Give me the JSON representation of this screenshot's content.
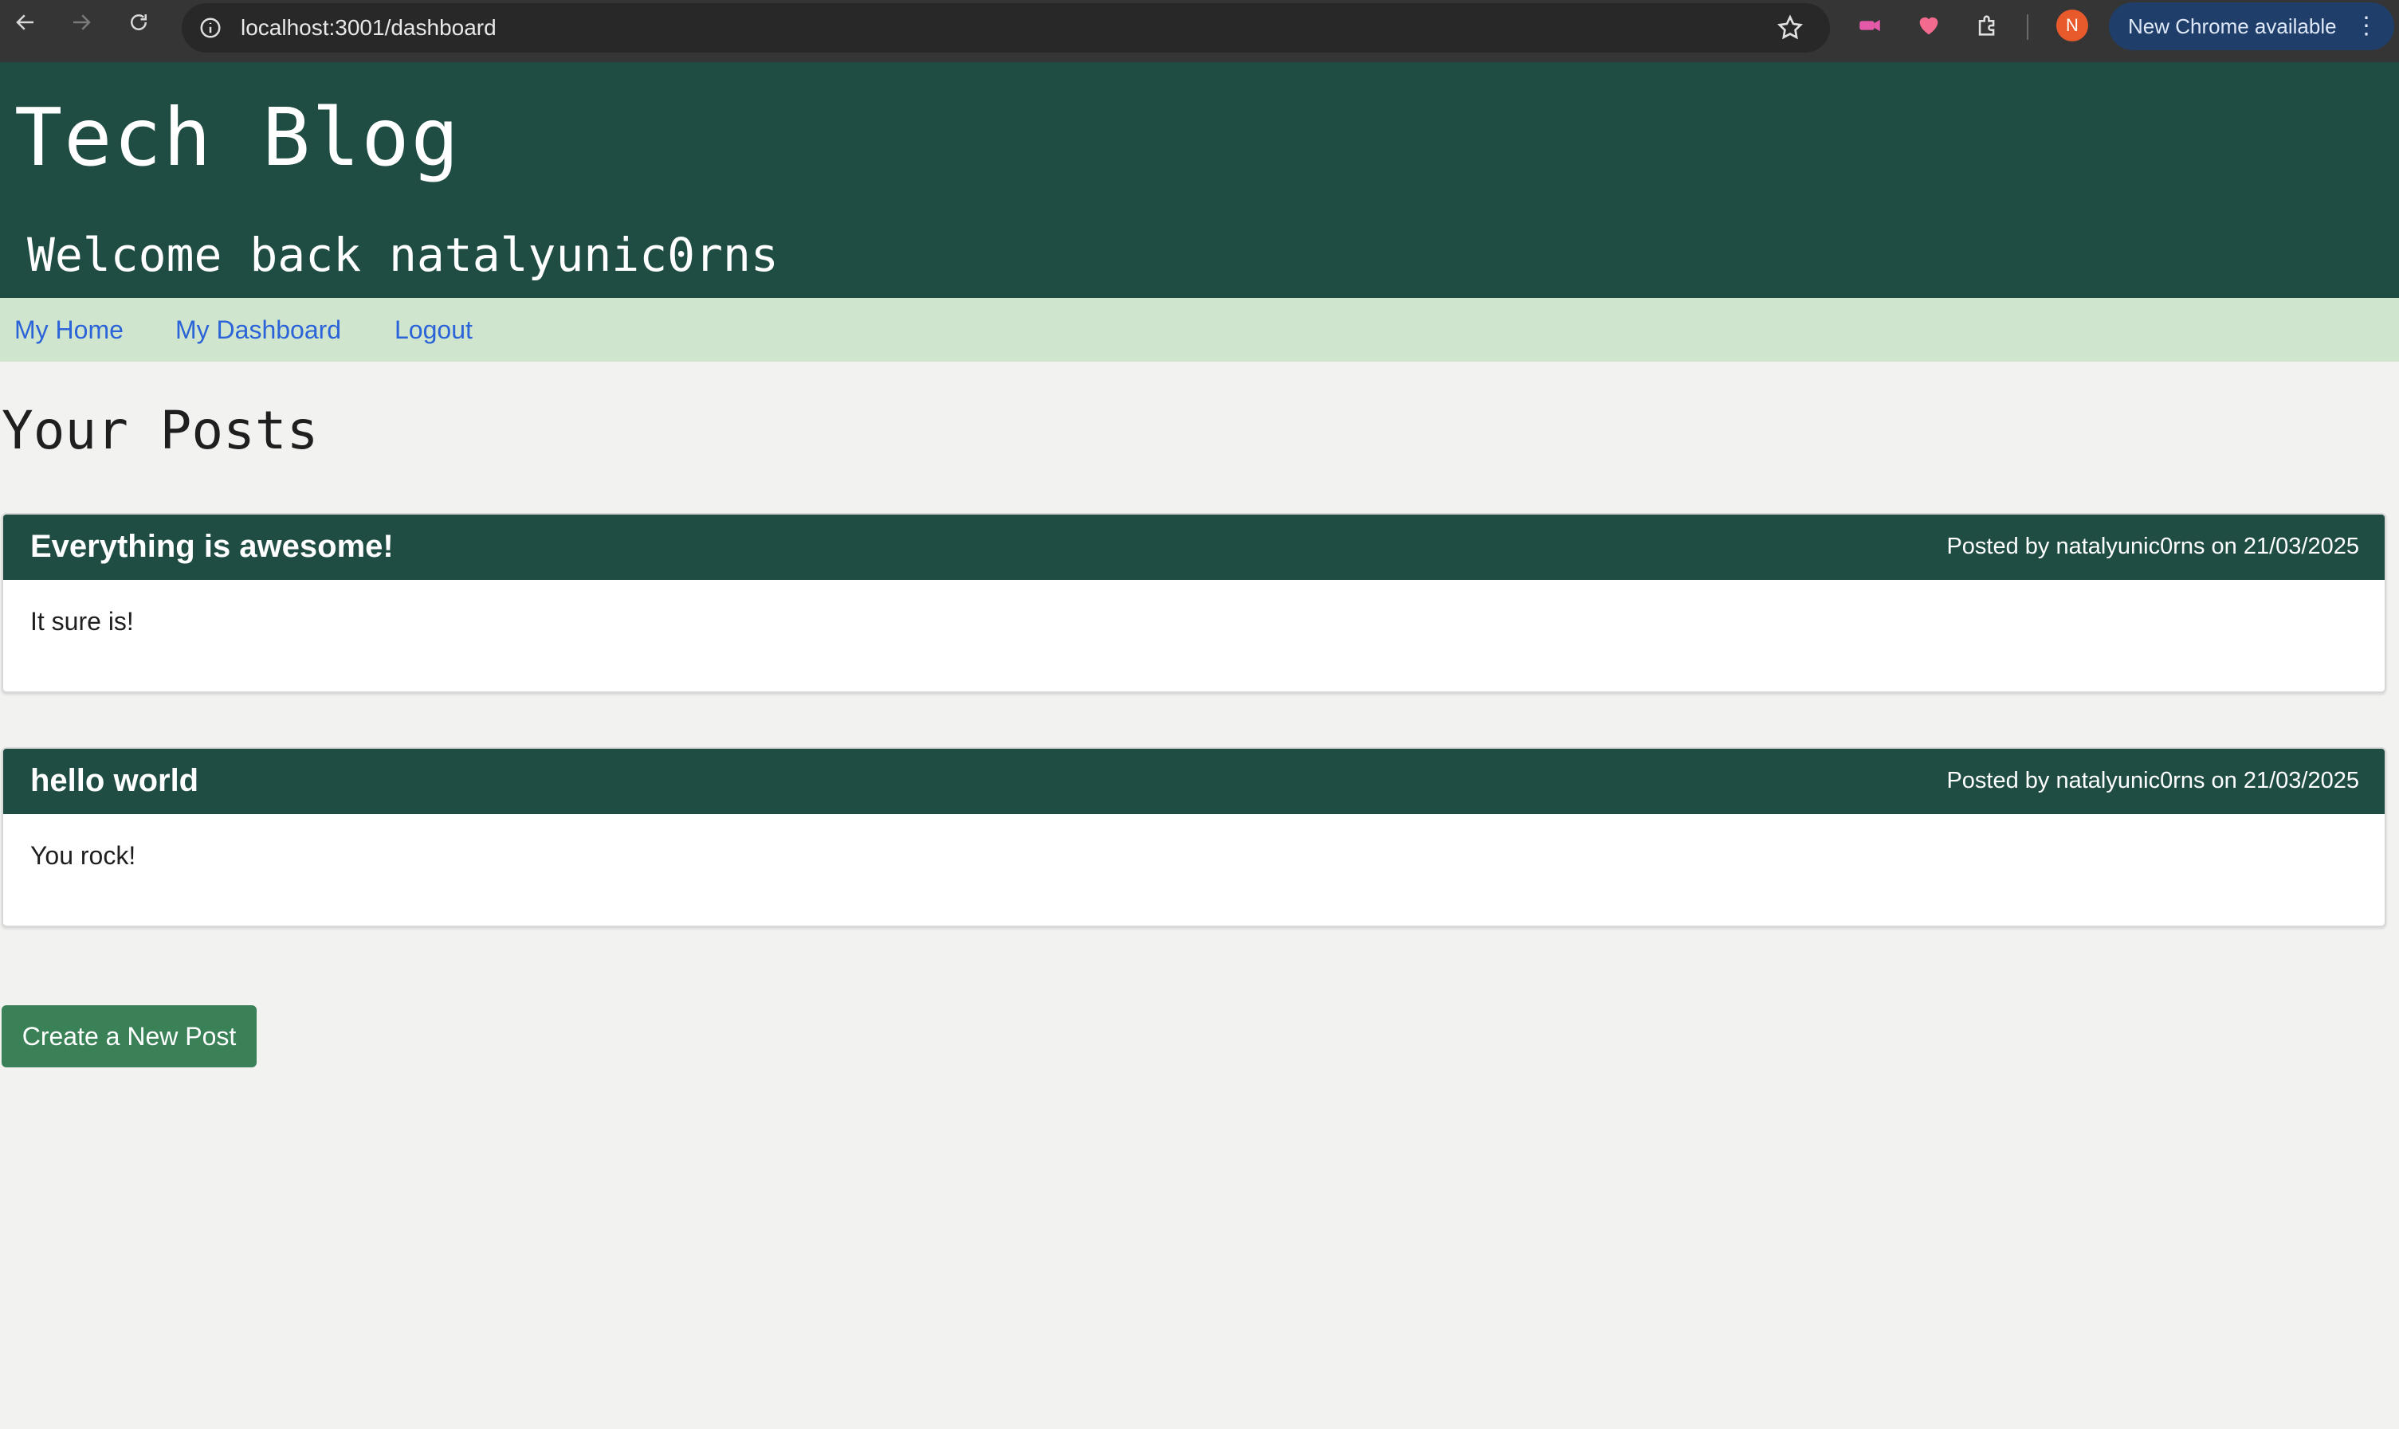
{
  "browser": {
    "url": "localhost:3001/dashboard",
    "back_icon": "arrow-left-icon",
    "forward_icon": "arrow-right-icon",
    "reload_icon": "reload-icon",
    "avatar_initial": "N",
    "update_label": "New Chrome available",
    "menu_icon": "kebab-menu-icon"
  },
  "site": {
    "title": "Tech Blog",
    "welcome": "Welcome back natalyunic0rns",
    "header_color": "#1f4d43"
  },
  "nav": {
    "items": [
      {
        "label": "My Home"
      },
      {
        "label": "My Dashboard"
      },
      {
        "label": "Logout"
      }
    ]
  },
  "main": {
    "heading": "Your Posts",
    "posts": [
      {
        "title": "Everything is awesome!",
        "meta": "Posted by natalyunic0rns on 21/03/2025",
        "body": "It sure is!"
      },
      {
        "title": "hello world",
        "meta": "Posted by natalyunic0rns on 21/03/2025",
        "body": "You rock!"
      }
    ],
    "create_label": "Create a New Post",
    "button_color": "#3b8158"
  }
}
